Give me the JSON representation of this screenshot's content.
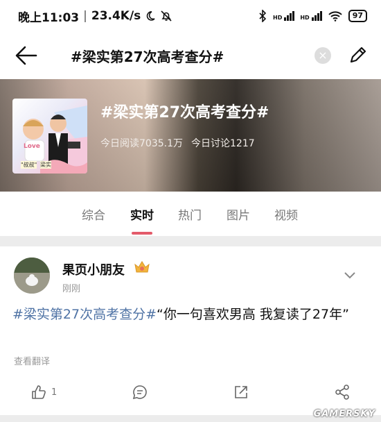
{
  "status_bar": {
    "time": "晚上11:03",
    "speed": "23.4K/s",
    "battery": "97",
    "signal_labels": [
      "HD",
      "HD"
    ]
  },
  "header": {
    "title": "#梁实第27次高考查分#",
    "clear_symbol": "×"
  },
  "banner": {
    "title": "#梁实第27次高考查分#",
    "reads": "今日阅读7035.1万",
    "discussions": "今日讨论1217",
    "thumb_badge": "Love",
    "thumb_caption_a": "\"叔叔\"",
    "thumb_caption_b": "梁实"
  },
  "tabs": [
    {
      "label": "综合",
      "active": false
    },
    {
      "label": "实时",
      "active": true
    },
    {
      "label": "热门",
      "active": false
    },
    {
      "label": "图片",
      "active": false
    },
    {
      "label": "视频",
      "active": false
    }
  ],
  "post": {
    "username": "果页小朋友",
    "time": "刚刚",
    "hashtag": "#梁实第27次高考查分#",
    "text": "“你一句喜欢男高 我复读了27年”",
    "translate": "查看翻译",
    "like_count": "1"
  },
  "watermark": "GAMERSKY",
  "colors": {
    "hashtag": "#4f73a5",
    "tab_indicator": "#e35b6a"
  }
}
